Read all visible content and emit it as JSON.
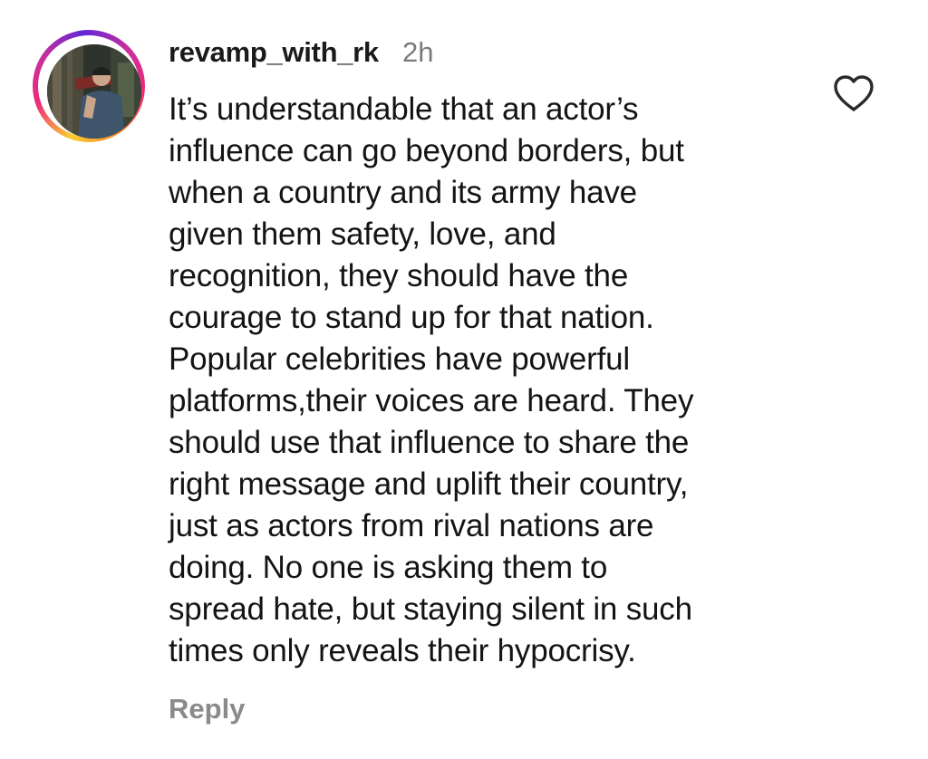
{
  "comment": {
    "username": "revamp_with_rk",
    "time": "2h",
    "text": "It’s understandable that an actor’s\ninfluence can go beyond borders, but\nwhen a country and its army have\ngiven them safety, love, and\nrecognition, they should have the\ncourage to stand up for that nation.\nPopular celebrities have powerful\nplatforms,their voices are heard. They\nshould use that influence to share the\nright message and uplift their country,\njust as actors from rival nations are\ndoing. No one is asking them to\nspread hate, but staying silent in such\ntimes only reveals their hypocrisy.",
    "reply_label": "Reply",
    "like_icon": "heart-outline-icon"
  },
  "colors": {
    "text": "#141414",
    "muted": "#7a7a7a",
    "reply": "#8a8a8a",
    "story_ring": [
      "#f9ce34",
      "#ee2a7b",
      "#6228d7"
    ]
  }
}
